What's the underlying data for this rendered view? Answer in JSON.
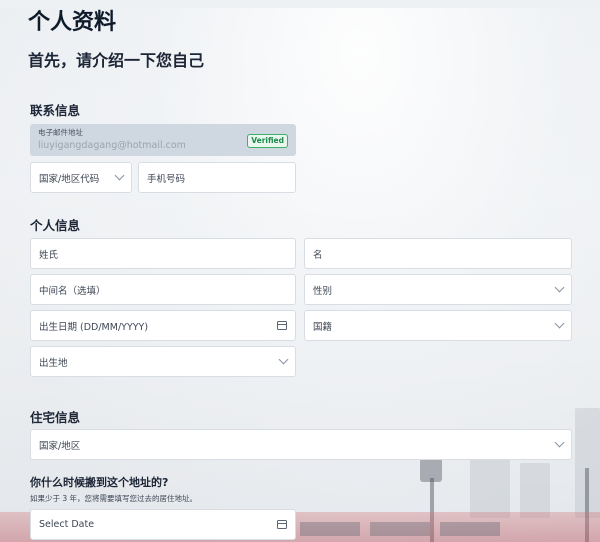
{
  "header": {
    "title": "个人资料",
    "subtitle": "首先，请介绍一下您自己"
  },
  "contact": {
    "section_title": "联系信息",
    "email_label": "电子邮件地址",
    "email_value": "liuyigangdagang@hotmail.com",
    "verified_badge": "Verified",
    "country_code_placeholder": "国家/地区代码",
    "phone_placeholder": "手机号码"
  },
  "personal": {
    "section_title": "个人信息",
    "surname_placeholder": "姓氏",
    "given_name_placeholder": "名",
    "middle_name_placeholder": "中间名（选填）",
    "gender_placeholder": "性别",
    "dob_placeholder": "出生日期 (DD/MM/YYYY)",
    "nationality_placeholder": "国籍",
    "birthplace_placeholder": "出生地"
  },
  "residence": {
    "section_title": "住宅信息",
    "country_placeholder": "国家/地区",
    "move_in_question": "你什么时候搬到这个地址的?",
    "move_in_hint": "如果少于 3 年，您将需要填写您过去的居住地址。",
    "move_in_date_placeholder": "Select Date"
  },
  "icons": {
    "chevron": "chevron-down-icon",
    "calendar": "calendar-icon"
  },
  "colors": {
    "title_text": "#0f1b2b",
    "email_box_bg": "#cfd8e1",
    "verified_green": "#1e8a4c",
    "field_border": "#d8dde3"
  }
}
